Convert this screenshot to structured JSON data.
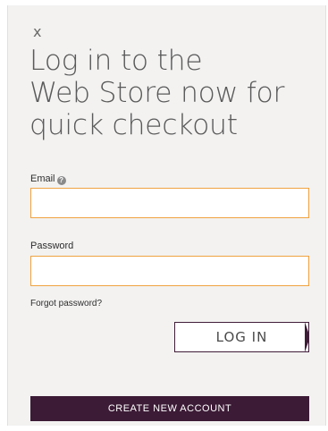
{
  "dialog": {
    "close_label": "x",
    "title": "Log in to the\nWeb Store now for\nquick checkout",
    "email": {
      "label": "Email",
      "help_icon": "question-circle-icon",
      "value": ""
    },
    "password": {
      "label": "Password",
      "value": ""
    },
    "forgot_label": "Forgot password?",
    "login_label": "LOG IN",
    "create_account_label": "CREATE NEW ACCOUNT"
  },
  "colors": {
    "field_border": "#f0a341",
    "accent": "#3c1b36",
    "panel_bg": "#f3f2f1",
    "title_text": "#5a5a5a"
  }
}
